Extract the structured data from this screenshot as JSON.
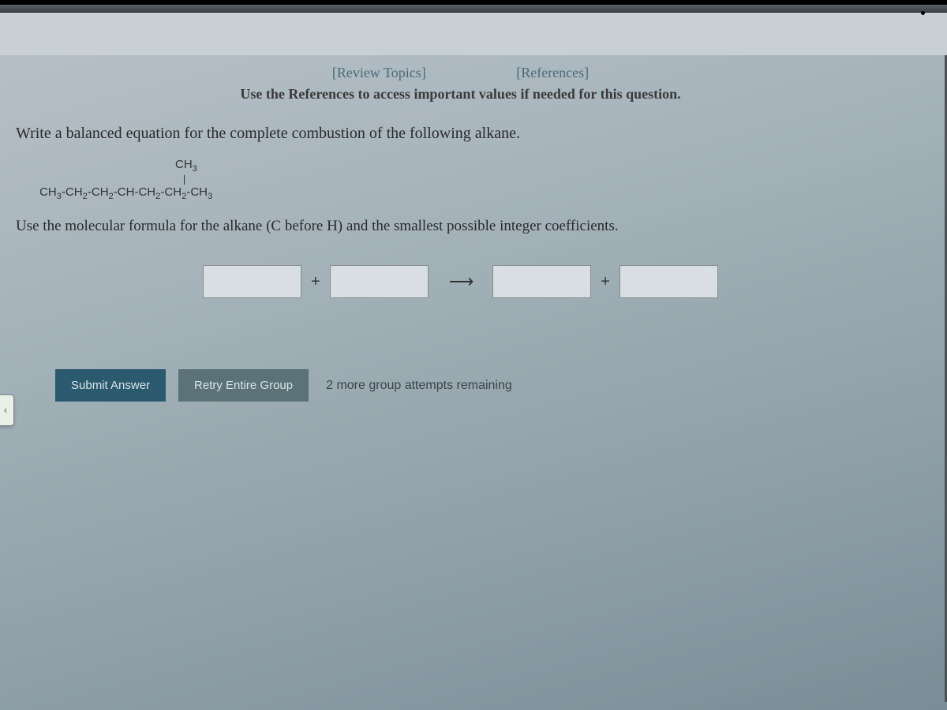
{
  "header": {
    "review_topics_link": "[Review Topics]",
    "references_link": "[References]",
    "hint_text": "Use the References to access important values if needed for this question."
  },
  "question": {
    "prompt": "Write a balanced equation for the complete combustion of the following alkane.",
    "formula_branch": "CH",
    "formula_branch_sub": "3",
    "formula_main_parts": [
      "CH",
      "3",
      "-CH",
      "2",
      "-CH",
      "2",
      "-CH-CH",
      "2",
      "-CH",
      "2",
      "-CH",
      "3"
    ],
    "instruction": "Use the molecular formula for the alkane (C before H) and the smallest possible integer coefficients."
  },
  "equation": {
    "symbol_plus": "+",
    "symbol_arrow": "⟶"
  },
  "actions": {
    "submit_label": "Submit Answer",
    "retry_label": "Retry Entire Group",
    "attempts_text": "2 more group attempts remaining"
  }
}
